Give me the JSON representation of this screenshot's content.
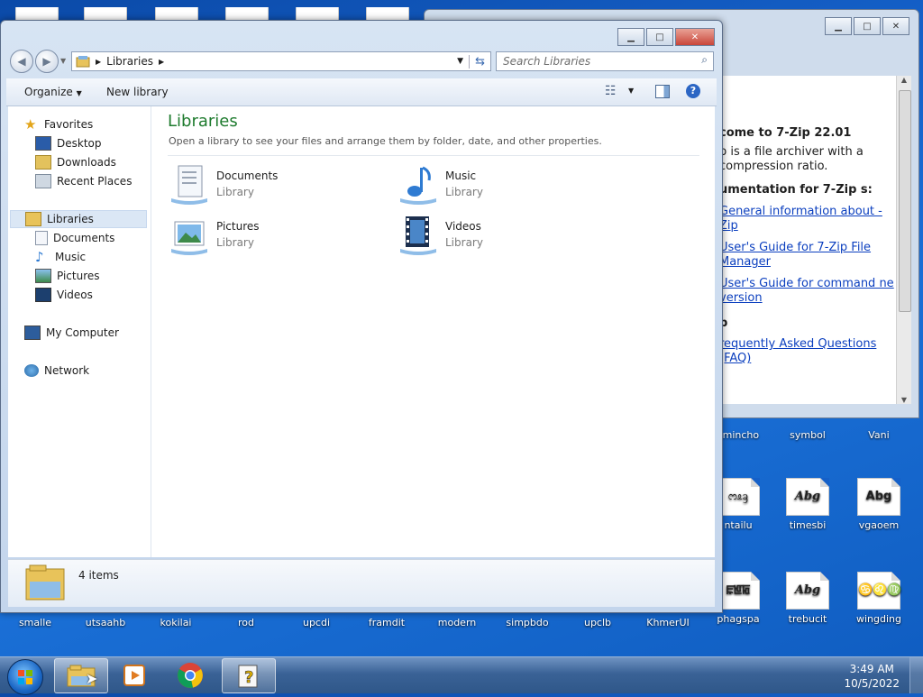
{
  "explorer": {
    "breadcrumb": "Libraries",
    "search_placeholder": "Search Libraries",
    "toolbar": {
      "organize": "Organize",
      "new_library": "New library"
    },
    "nav": {
      "favorites": "Favorites",
      "favorites_items": [
        "Desktop",
        "Downloads",
        "Recent Places"
      ],
      "libraries": "Libraries",
      "libraries_items": [
        "Documents",
        "Music",
        "Pictures",
        "Videos"
      ],
      "my_computer": "My Computer",
      "network": "Network"
    },
    "main": {
      "title": "Libraries",
      "subtitle": "Open a library to see your files and arrange them by folder, date, and other properties.",
      "items": [
        {
          "name": "Documents",
          "type": "Library"
        },
        {
          "name": "Music",
          "type": "Library"
        },
        {
          "name": "Pictures",
          "type": "Library"
        },
        {
          "name": "Videos",
          "type": "Library"
        }
      ]
    },
    "details": {
      "count": "4 items"
    }
  },
  "help_window": {
    "heading1": "come to 7-Zip 22.01",
    "para": "p is a file archiver with a compression ratio.",
    "heading2": "umentation for 7-Zip s:",
    "links": [
      "General information about -Zip",
      "User's Guide for 7-Zip File Manager",
      "User's Guide for command ne version"
    ],
    "heading3": "p",
    "faq": "requently Asked Questions (FAQ)"
  },
  "desktop": {
    "right_icons": [
      {
        "label": "smincho",
        "glyph": ""
      },
      {
        "label": "symbol",
        "glyph": ""
      },
      {
        "label": "Vani",
        "glyph": ""
      },
      {
        "label": "ntailu",
        "glyph": "ᦂᦸᦃ"
      },
      {
        "label": "timesbi",
        "glyph": "Abg"
      },
      {
        "label": "vgaoem",
        "glyph": "Abg"
      },
      {
        "label": "phagspa",
        "glyph": "ꡀꡁꡂ"
      },
      {
        "label": "trebucit",
        "glyph": "Abg"
      },
      {
        "label": "wingding",
        "glyph": "♋♌♍"
      }
    ],
    "bottom_labels": [
      "smalle",
      "utsaahb",
      "kokilai",
      "rod",
      "upcdi",
      "framdit",
      "modern",
      "simpbdo",
      "upclb",
      "KhmerUI"
    ]
  },
  "taskbar": {
    "time": "3:49 AM",
    "date": "10/5/2022"
  },
  "colors": {
    "title_green": "#1e7b2e",
    "link_blue": "#0b3fbf",
    "nav_selected": "#dbe7f5"
  }
}
